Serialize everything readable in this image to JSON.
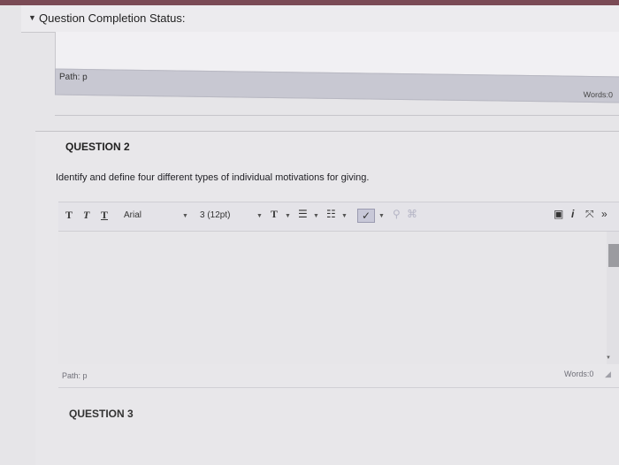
{
  "status": {
    "label": "Question Completion Status:"
  },
  "previous_answer": {
    "path": "Path: p",
    "words": "Words:0"
  },
  "question2": {
    "title": "QUESTION 2",
    "prompt": "Identify and define four different types of individual motivations for giving."
  },
  "toolbar": {
    "bold": "T",
    "italic": "T",
    "underline": "T",
    "font_family": "Arial",
    "font_size": "3 (12pt)",
    "text_style": "T",
    "icons": [
      "bold-icon",
      "italic-icon",
      "underline-icon",
      "font-color-icon",
      "unordered-list-icon",
      "ordered-list-icon",
      "spellcheck-icon",
      "link-icon",
      "unlink-icon",
      "preview-icon",
      "info-icon",
      "fullscreen-icon",
      "expand-icon"
    ]
  },
  "editor": {
    "path": "Path: p",
    "words": "Words:0"
  },
  "question3": {
    "title": "QUESTION 3"
  }
}
